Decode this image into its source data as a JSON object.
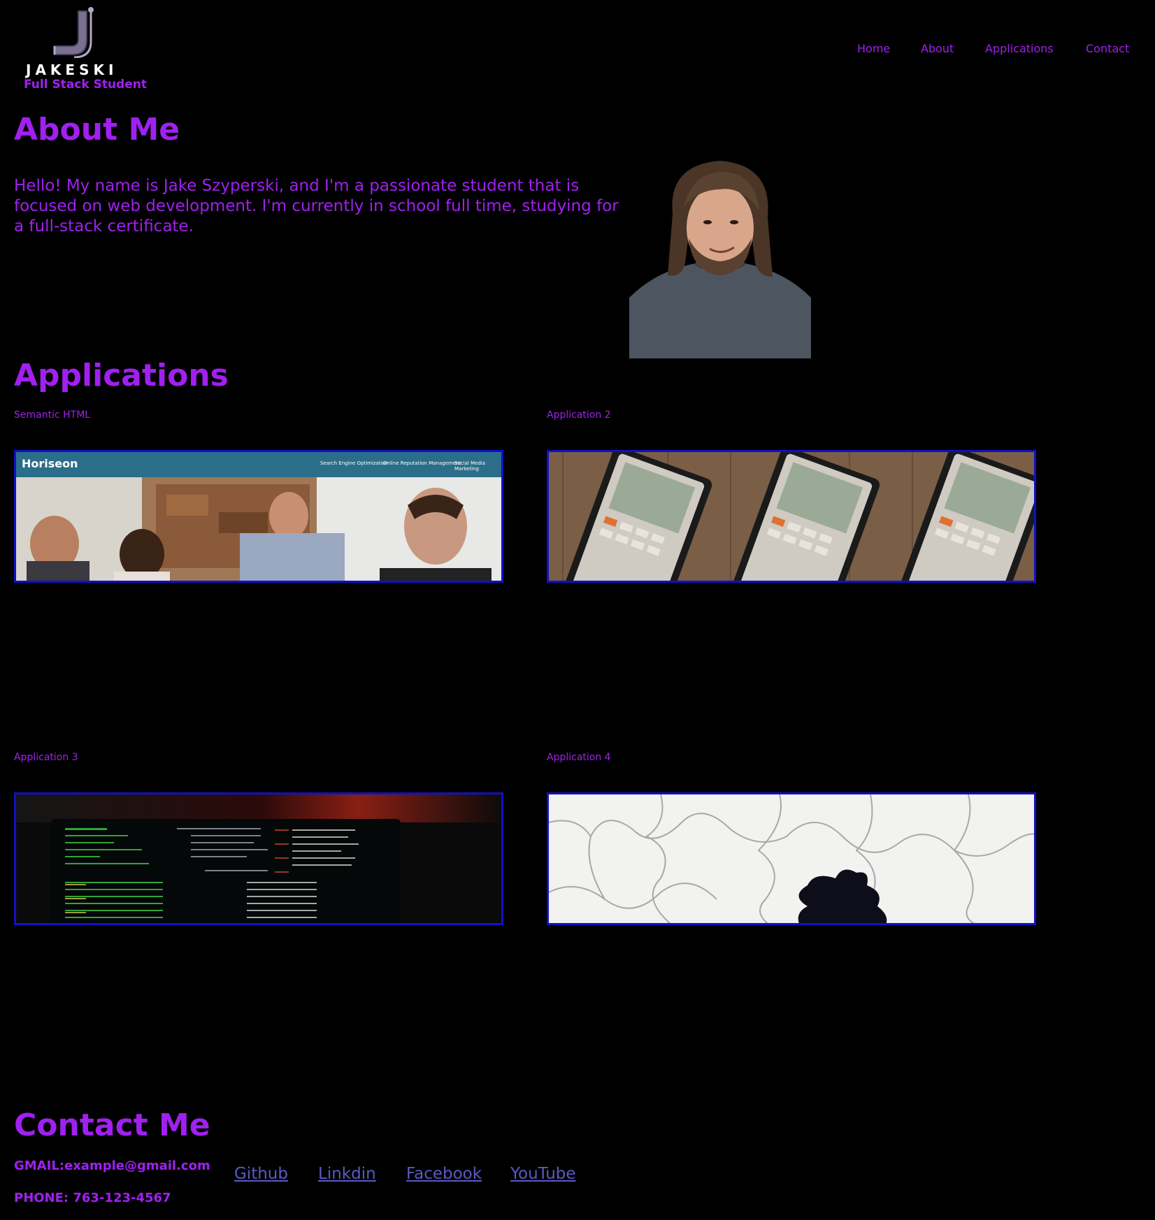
{
  "header": {
    "logo_word": "JAKESKI",
    "logo_subtitle": "Full Stack Student",
    "nav": [
      "Home",
      "About",
      "Applications",
      "Contact"
    ]
  },
  "about": {
    "title": "About Me",
    "text": "Hello! My name is Jake Szyperski, and I'm a passionate student that is focused on web development. I'm currently in school full time, studying for a full-stack certificate."
  },
  "applications": {
    "title": "Applications",
    "items": [
      {
        "title": "Semantic HTML",
        "image": "horiseon-site-screenshot",
        "image_brand": "Horiseon",
        "image_nav": [
          "Search Engine Optimization",
          "Online Reputation Management",
          "Social Media Marketing"
        ]
      },
      {
        "title": "Application 2",
        "image": "calculators-photo"
      },
      {
        "title": "Application 3",
        "image": "terminal-screen-photo"
      },
      {
        "title": "Application 4",
        "image": "puzzle-pieces-photo"
      }
    ]
  },
  "contact": {
    "title": "Contact Me",
    "gmail": "GMAIL:example@gmail.com",
    "phone": "PHONE: 763-123-4567",
    "links": [
      "Github",
      "Linkdin",
      "Facebook",
      "YouTube"
    ]
  },
  "colors": {
    "background": "#000000",
    "accent": "#a020f0",
    "image_border": "#1010c8",
    "link": "#5a5ac0"
  }
}
